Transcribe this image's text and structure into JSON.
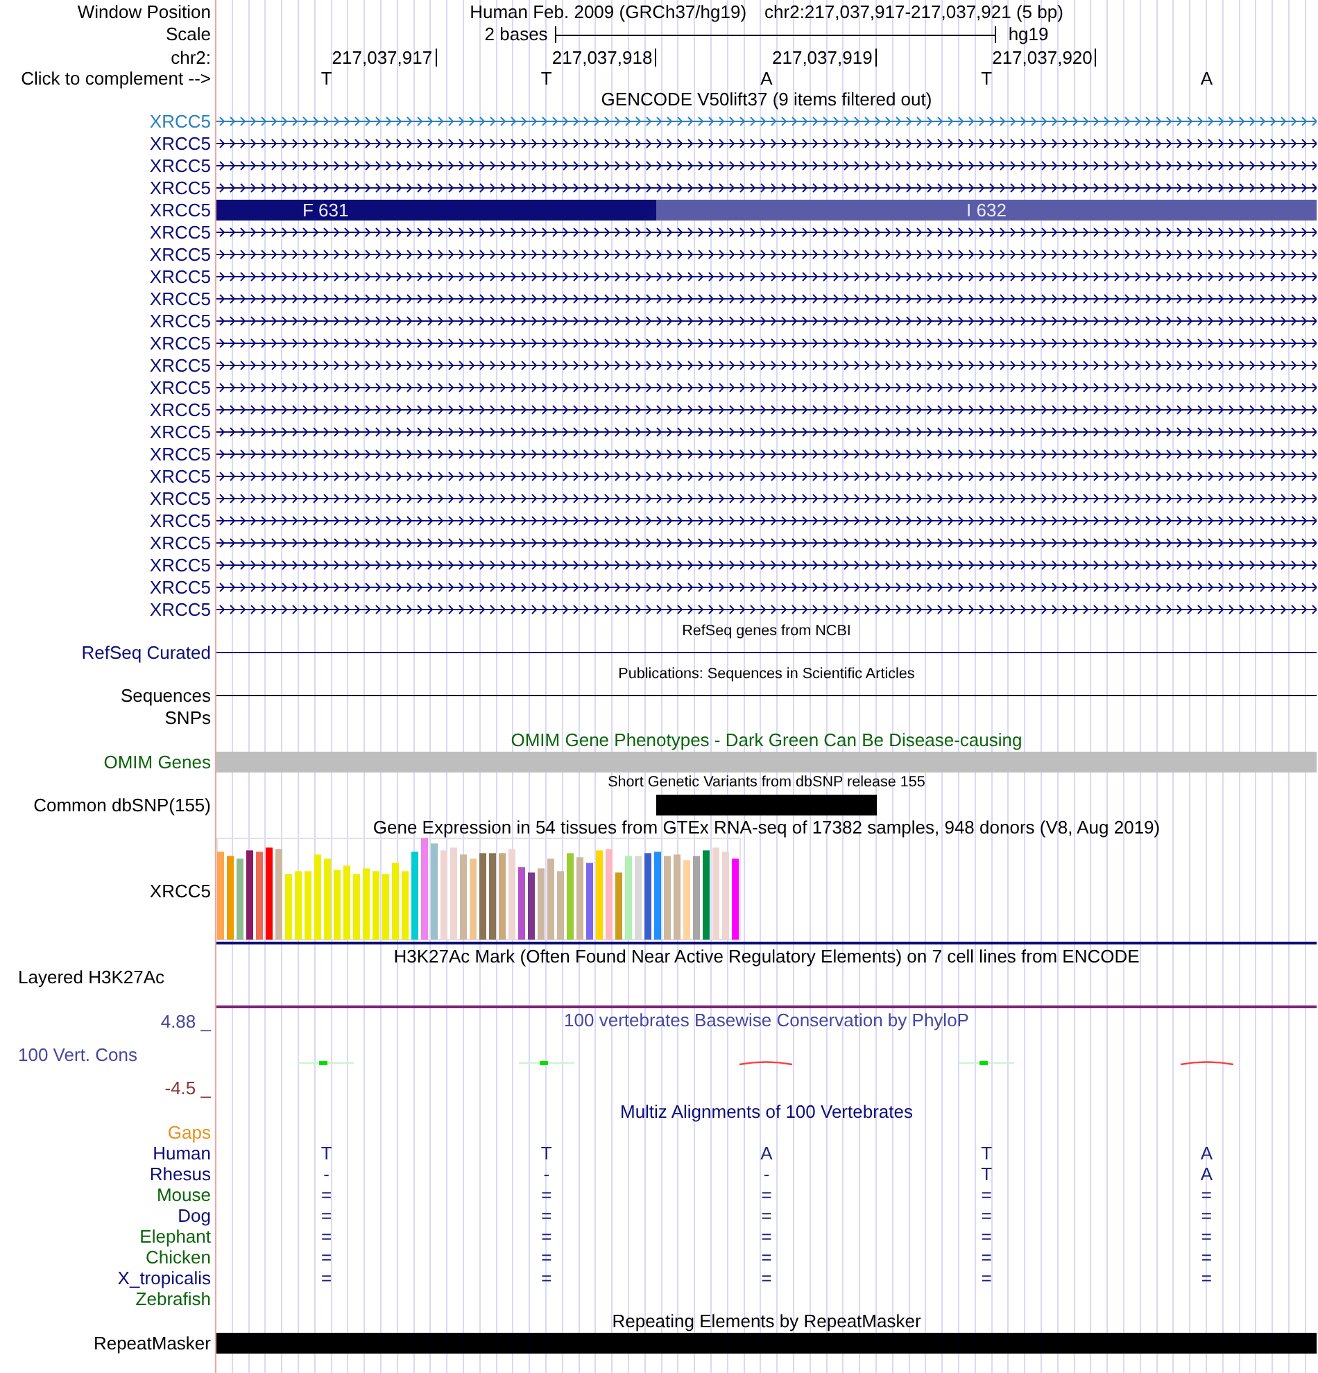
{
  "position": {
    "label": "Window Position",
    "assembly": "Human Feb. 2009 (GRCh37/hg19)",
    "range": "chr2:217,037,917-217,037,921 (5 bp)"
  },
  "scale": {
    "label": "Scale",
    "span": "2 bases",
    "assembly": "hg19"
  },
  "ruler": {
    "label": "chr2:",
    "positions": [
      "217,037,917",
      "217,037,918",
      "217,037,919",
      "217,037,920"
    ]
  },
  "sequence": {
    "label": "Click to complement -->",
    "bases": [
      "T",
      "T",
      "A",
      "T",
      "A"
    ]
  },
  "tracks": [
    {
      "kind": "genes",
      "title": {
        "text": "GENCODE V50lift37 (9 items filtered out)",
        "color": "#000000"
      },
      "items": [
        {
          "name": "XRCC5",
          "color": "#2a7fbf",
          "kind": "intron"
        },
        {
          "name": "XRCC5",
          "color": "#0c0c78",
          "kind": "intron"
        },
        {
          "name": "XRCC5",
          "color": "#0c0c78",
          "kind": "intron"
        },
        {
          "name": "XRCC5",
          "color": "#0c0c78",
          "kind": "intron"
        },
        {
          "name": "XRCC5",
          "color": "#0c0c78",
          "kind": "exon",
          "codons": [
            {
              "label": "F 631",
              "color": "#0c0c78"
            },
            {
              "label": "I 632",
              "color": "#5a5ca8"
            }
          ]
        },
        {
          "name": "XRCC5",
          "color": "#0c0c78",
          "kind": "intron"
        },
        {
          "name": "XRCC5",
          "color": "#0c0c78",
          "kind": "intron"
        },
        {
          "name": "XRCC5",
          "color": "#0c0c78",
          "kind": "intron"
        },
        {
          "name": "XRCC5",
          "color": "#0c0c78",
          "kind": "intron"
        },
        {
          "name": "XRCC5",
          "color": "#0c0c78",
          "kind": "intron"
        },
        {
          "name": "XRCC5",
          "color": "#0c0c78",
          "kind": "intron"
        },
        {
          "name": "XRCC5",
          "color": "#0c0c78",
          "kind": "intron"
        },
        {
          "name": "XRCC5",
          "color": "#0c0c78",
          "kind": "intron"
        },
        {
          "name": "XRCC5",
          "color": "#0c0c78",
          "kind": "intron"
        },
        {
          "name": "XRCC5",
          "color": "#0c0c78",
          "kind": "intron"
        },
        {
          "name": "XRCC5",
          "color": "#0c0c78",
          "kind": "intron"
        },
        {
          "name": "XRCC5",
          "color": "#0c0c78",
          "kind": "intron"
        },
        {
          "name": "XRCC5",
          "color": "#0c0c78",
          "kind": "intron"
        },
        {
          "name": "XRCC5",
          "color": "#0c0c78",
          "kind": "intron"
        },
        {
          "name": "XRCC5",
          "color": "#0c0c78",
          "kind": "intron"
        },
        {
          "name": "XRCC5",
          "color": "#0c0c78",
          "kind": "intron"
        },
        {
          "name": "XRCC5",
          "color": "#0c0c78",
          "kind": "intron"
        },
        {
          "name": "XRCC5",
          "color": "#0c0c78",
          "kind": "intron"
        }
      ]
    },
    {
      "kind": "line",
      "title": {
        "text": "RefSeq genes from NCBI",
        "color": "#000000"
      },
      "label": "RefSeq Curated",
      "color": "#0c0c78"
    },
    {
      "kind": "line",
      "title": {
        "text": "Publications: Sequences in Scientific Articles",
        "color": "#000000"
      },
      "label": "Sequences",
      "color": "#000000"
    },
    {
      "kind": "empty",
      "label": "SNPs",
      "color": "#000000"
    },
    {
      "kind": "bar",
      "title": {
        "text": "OMIM Gene Phenotypes - Dark Green Can Be Disease-causing",
        "color": "#0b640b"
      },
      "label": "OMIM Genes",
      "color": "#0b640b",
      "bar": {
        "color": "#bebebe"
      }
    },
    {
      "kind": "variant",
      "title": {
        "text": "Short Genetic Variants from dbSNP release 155",
        "color": "#000000"
      },
      "label": "Common dbSNP(155)",
      "color": "#000000",
      "bar": {
        "color": "#000000"
      }
    },
    {
      "kind": "expression",
      "title": {
        "text": "Gene Expression in 54 tissues from GTEx RNA-seq of 17382 samples, 948 donors (V8, Aug 2019)",
        "color": "#000000"
      },
      "label": "XRCC5",
      "color": "#000000",
      "bars": [
        {
          "color": "#ffa54f"
        },
        {
          "color": "#ee9a00"
        },
        {
          "color": "#8fbc8f"
        },
        {
          "color": "#8b1c62"
        },
        {
          "color": "#ee6a50"
        },
        {
          "color": "#ff0000"
        },
        {
          "color": "#cdb79e"
        },
        {
          "color": "#eeee00"
        },
        {
          "color": "#eeee00"
        },
        {
          "color": "#eeee00"
        },
        {
          "color": "#eeee00"
        },
        {
          "color": "#eeee00"
        },
        {
          "color": "#eeee00"
        },
        {
          "color": "#eeee00"
        },
        {
          "color": "#eeee00"
        },
        {
          "color": "#eeee00"
        },
        {
          "color": "#eeee00"
        },
        {
          "color": "#eeee00"
        },
        {
          "color": "#eeee00"
        },
        {
          "color": "#eeee00"
        },
        {
          "color": "#00ced1"
        },
        {
          "color": "#ee82ee"
        },
        {
          "color": "#9ac0cd"
        },
        {
          "color": "#eed5d2"
        },
        {
          "color": "#eed5d2"
        },
        {
          "color": "#cdb79e"
        },
        {
          "color": "#eec591"
        },
        {
          "color": "#8b7355"
        },
        {
          "color": "#8b7355"
        },
        {
          "color": "#cdaa7d"
        },
        {
          "color": "#eed5d2"
        },
        {
          "color": "#b452cd"
        },
        {
          "color": "#7a378b"
        },
        {
          "color": "#cdb79e"
        },
        {
          "color": "#cdb79e"
        },
        {
          "color": "#cdb79e"
        },
        {
          "color": "#9acd32"
        },
        {
          "color": "#cdb79e"
        },
        {
          "color": "#7b68ee"
        },
        {
          "color": "#ffd700"
        },
        {
          "color": "#ffb6c1"
        },
        {
          "color": "#cd9b1d"
        },
        {
          "color": "#b4eeb4"
        },
        {
          "color": "#d9d9d9"
        },
        {
          "color": "#3a5fcd"
        },
        {
          "color": "#1e90ff"
        },
        {
          "color": "#cdb79e"
        },
        {
          "color": "#cdb79e"
        },
        {
          "color": "#ffd39b"
        },
        {
          "color": "#a6a6a6"
        },
        {
          "color": "#008b45"
        },
        {
          "color": "#eed5d2"
        },
        {
          "color": "#eed5d2"
        },
        {
          "color": "#ff00ff"
        }
      ]
    },
    {
      "kind": "layered",
      "title": {
        "text": "H3K27Ac Mark (Often Found Near Active Regulatory Elements) on 7 cell lines from ENCODE",
        "color": "#000000"
      },
      "label": "Layered H3K27Ac",
      "color": "#000000",
      "line": {
        "color": "#7e2275"
      }
    },
    {
      "kind": "wiggle",
      "title": {
        "text": "100 vertebrates Basewise Conservation by PhyloP",
        "color": "#4646a0"
      },
      "label": "100 Vert. Cons",
      "color": "#4646a0",
      "max": "4.88 _",
      "min": "-4.5 _",
      "marks": [
        {
          "kind": "positive",
          "color": "#00e000"
        },
        {
          "kind": "positive",
          "color": "#00e000"
        },
        {
          "kind": "negative",
          "color": "#ff3c3c"
        },
        {
          "kind": "positive",
          "color": "#00e000"
        },
        {
          "kind": "negative",
          "color": "#ff3c3c"
        }
      ]
    },
    {
      "kind": "alignment",
      "title": {
        "text": "Multiz Alignments of 100 Vertebrates",
        "color": "#0c0c78"
      },
      "species": [
        {
          "name": "Gaps",
          "color": "#e8901c"
        },
        {
          "name": "Human",
          "color": "#0c0c78",
          "bases": [
            "T",
            "T",
            "A",
            "T",
            "A"
          ]
        },
        {
          "name": "Rhesus",
          "color": "#0c0c78",
          "bases": [
            "-",
            "-",
            "-",
            "T",
            "A"
          ]
        },
        {
          "name": "Mouse",
          "color": "#0b640b",
          "bases": [
            "=",
            "=",
            "=",
            "=",
            "="
          ]
        },
        {
          "name": "Dog",
          "color": "#0c0c78",
          "bases": [
            "=",
            "=",
            "=",
            "=",
            "="
          ]
        },
        {
          "name": "Elephant",
          "color": "#0b640b",
          "bases": [
            "=",
            "=",
            "=",
            "=",
            "="
          ]
        },
        {
          "name": "Chicken",
          "color": "#0b640b",
          "bases": [
            "=",
            "=",
            "=",
            "=",
            "="
          ]
        },
        {
          "name": "X_tropicalis",
          "color": "#0c0c78",
          "bases": [
            "=",
            "=",
            "=",
            "=",
            "="
          ]
        },
        {
          "name": "Zebrafish",
          "color": "#0b640b"
        }
      ]
    },
    {
      "kind": "bar",
      "title": {
        "text": "Repeating Elements by RepeatMasker",
        "color": "#000000"
      },
      "label": "RepeatMasker",
      "color": "#000000",
      "bar": {
        "color": "#000000"
      }
    }
  ]
}
